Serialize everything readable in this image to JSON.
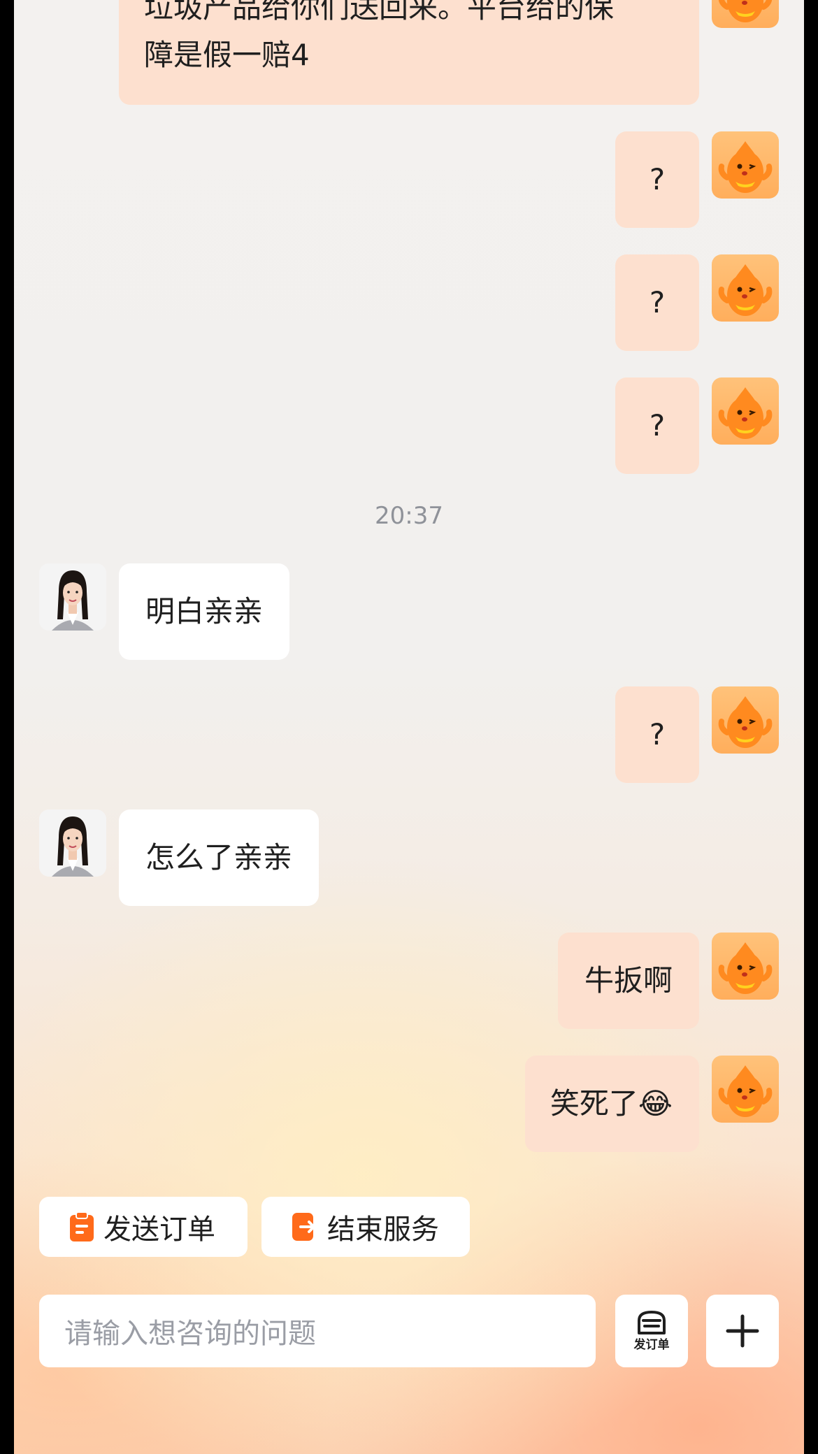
{
  "messages": [
    {
      "from": "me",
      "line1": "垃圾产品给你们送回来。平台给的保",
      "line2": "障是假一赔4"
    },
    {
      "from": "me",
      "text": "?"
    },
    {
      "from": "me",
      "text": "?"
    },
    {
      "from": "me",
      "text": "?"
    },
    {
      "from": "them",
      "text": "明白亲亲"
    },
    {
      "from": "me",
      "text": "?"
    },
    {
      "from": "them",
      "text": "怎么了亲亲"
    },
    {
      "from": "me",
      "text": "牛扳啊"
    },
    {
      "from": "me",
      "text": "笑死了😂"
    }
  ],
  "timestamp": "20:37",
  "quick_actions": {
    "send_order": "发送订单",
    "end_service": "结束服务"
  },
  "composer": {
    "placeholder": "请输入想咨询的问题",
    "order_button_label": "发订单"
  },
  "colors": {
    "my_bubble": "#fde0cf",
    "their_bubble": "#ffffff",
    "accent": "#ff6a1a"
  }
}
